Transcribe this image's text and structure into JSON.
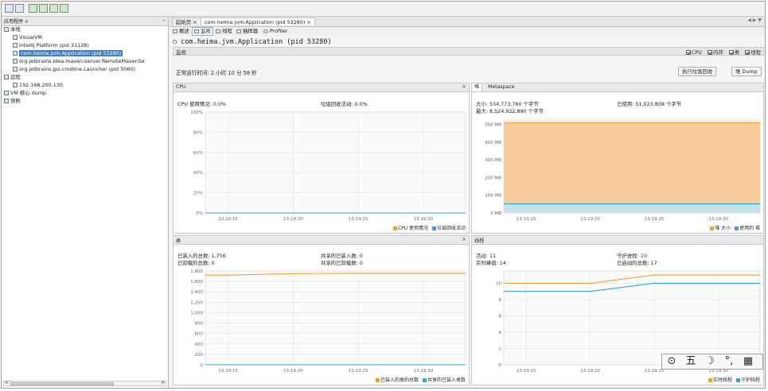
{
  "toolbar": {
    "buttons": [
      "open-icon",
      "save-icon",
      "add-jmx-icon",
      "add-remote-host-icon",
      "add-core-dump-icon",
      "add-snapshot-icon"
    ]
  },
  "left_panel": {
    "tab_label": "应用程序 ×",
    "minimize": "–",
    "tree": [
      {
        "label": "本地",
        "indent": 0,
        "icon": "computer-icon"
      },
      {
        "label": "VisualVM",
        "indent": 1,
        "icon": "visualvm-icon"
      },
      {
        "label": "IntelliJ Platform (pid 31128)",
        "indent": 1,
        "icon": "intellij-icon"
      },
      {
        "label": "com.heima.jvm.Application (pid 53280)",
        "indent": 1,
        "icon": "java-app-icon",
        "selected": true
      },
      {
        "label": "org.jetbrains.idea.maven.server.RemoteMavenSe",
        "indent": 1,
        "icon": "java-app-icon"
      },
      {
        "label": "org.jetbrains.jps.cmdline.Launcher (pid 5060)",
        "indent": 1,
        "icon": "java-app-icon"
      },
      {
        "label": "远程",
        "indent": 0,
        "icon": "remote-icon"
      },
      {
        "label": "192.168.200.130",
        "indent": 1,
        "icon": "host-icon"
      },
      {
        "label": "VM 核心 dump",
        "indent": 0,
        "icon": "core-dump-icon"
      },
      {
        "label": "快照",
        "indent": 0,
        "icon": "snapshot-icon"
      }
    ],
    "scroll_left": "<",
    "scroll_right": ">"
  },
  "tabs": [
    {
      "label": "起始页 ×"
    },
    {
      "label": "com.heima.jvm.Application (pid 53280) ×",
      "active": true
    }
  ],
  "tab_nav": "◀ ▶ ▼",
  "subtabs": [
    {
      "label": "概述"
    },
    {
      "label": "监视",
      "active": true
    },
    {
      "label": "线程"
    },
    {
      "label": "抽样器"
    },
    {
      "label": "Profiler"
    }
  ],
  "app_title": "com.heima.jvm.Application (pid 53280)",
  "monitor": {
    "label": "监视",
    "checkboxes": [
      "CPU",
      "内存",
      "类",
      "线程"
    ],
    "uptime": "正常运行时间: 2 小时 10 分 58 秒",
    "gc_button": "执行垃圾回收",
    "dump_button": "堆 Dump"
  },
  "cpu_panel": {
    "title": "CPU",
    "close": "×",
    "usage": "CPU 使用情况: 0.0%",
    "gc": "垃圾回收活动: 0.0%",
    "legend": [
      "CPU 使用情况",
      "垃圾回收活动"
    ]
  },
  "heap_panel": {
    "tab1": "堆",
    "tab2": "Metaspace",
    "size": "大小: 534,773,760 个字节",
    "used": "已使用: 51,023,808 个字节",
    "max": "最大: 8,524,922,880 个字节",
    "legend": [
      "堆 大小",
      "使用的 堆"
    ]
  },
  "classes_panel": {
    "title": "类",
    "close": "×",
    "loaded_total": "已装入的总数: 1,756",
    "shared_loaded": "共享的已装入数: 0",
    "unloaded_total": "已卸载的总数: 0",
    "shared_unloaded": "共享的已卸载数: 0",
    "legend": [
      "已装入的类的总数",
      "共享的已装入类数"
    ]
  },
  "threads_panel": {
    "title": "线程",
    "live": "活动: 11",
    "daemon": "守护进程: 10",
    "peak": "实时峰值: 14",
    "started": "已启动的总数: 17",
    "legend": [
      "实时线程",
      "守护线程"
    ]
  },
  "ime_toolbar": {
    "items": [
      "⊙",
      "五",
      "☽",
      "°,",
      "▦",
      "⚙"
    ]
  },
  "colors": {
    "orange": "#f0a030",
    "blue": "#29a8d8",
    "heap_fill": "#f5c48a",
    "select": "#3a7fd5"
  },
  "chart_data": [
    {
      "type": "line",
      "title": "CPU",
      "x": [
        "13:19:15",
        "13:19:20",
        "13:19:25",
        "13:19:30"
      ],
      "yticks": [
        "0%",
        "20%",
        "40%",
        "60%",
        "80%",
        "100%"
      ],
      "ylim": [
        0,
        100
      ],
      "series": [
        {
          "name": "CPU 使用情况",
          "values": [
            0,
            0,
            0,
            0
          ]
        },
        {
          "name": "垃圾回收活动",
          "values": [
            0,
            0,
            0,
            0
          ]
        }
      ]
    },
    {
      "type": "area",
      "title": "Metaspace",
      "x": [
        "13:19:15",
        "13:19:20",
        "13:19:25",
        "13:19:30"
      ],
      "yticks": [
        "0 MB",
        "100 MB",
        "200 MB",
        "300 MB",
        "400 MB",
        "500 MB"
      ],
      "ylim": [
        0,
        525
      ],
      "series": [
        {
          "name": "堆 大小",
          "values": [
            510,
            510,
            510,
            510
          ]
        },
        {
          "name": "使用的 堆",
          "values": [
            51,
            51,
            51,
            51
          ]
        }
      ]
    },
    {
      "type": "line",
      "title": "类",
      "x": [
        "13:19:15",
        "13:19:20",
        "13:19:25",
        "13:19:30"
      ],
      "yticks": [
        "0",
        "200",
        "400",
        "600",
        "800",
        "1,000",
        "1,200",
        "1,400",
        "1,600",
        "1,800"
      ],
      "ylim": [
        0,
        1800
      ],
      "series": [
        {
          "name": "已装入的类的总数",
          "values": [
            1720,
            1750,
            1756,
            1756
          ]
        },
        {
          "name": "共享的已装入类数",
          "values": [
            0,
            0,
            0,
            0
          ]
        }
      ]
    },
    {
      "type": "line",
      "title": "线程",
      "x": [
        "13:19:15",
        "13:19:20",
        "13:19:25",
        "13:19:30"
      ],
      "yticks": [
        "0",
        "2",
        "4",
        "6",
        "8",
        "10"
      ],
      "ylim": [
        0,
        11.5
      ],
      "series": [
        {
          "name": "实时线程",
          "values": [
            10,
            10,
            11,
            11
          ]
        },
        {
          "name": "守护线程",
          "values": [
            9,
            9,
            10,
            10
          ]
        }
      ]
    }
  ]
}
